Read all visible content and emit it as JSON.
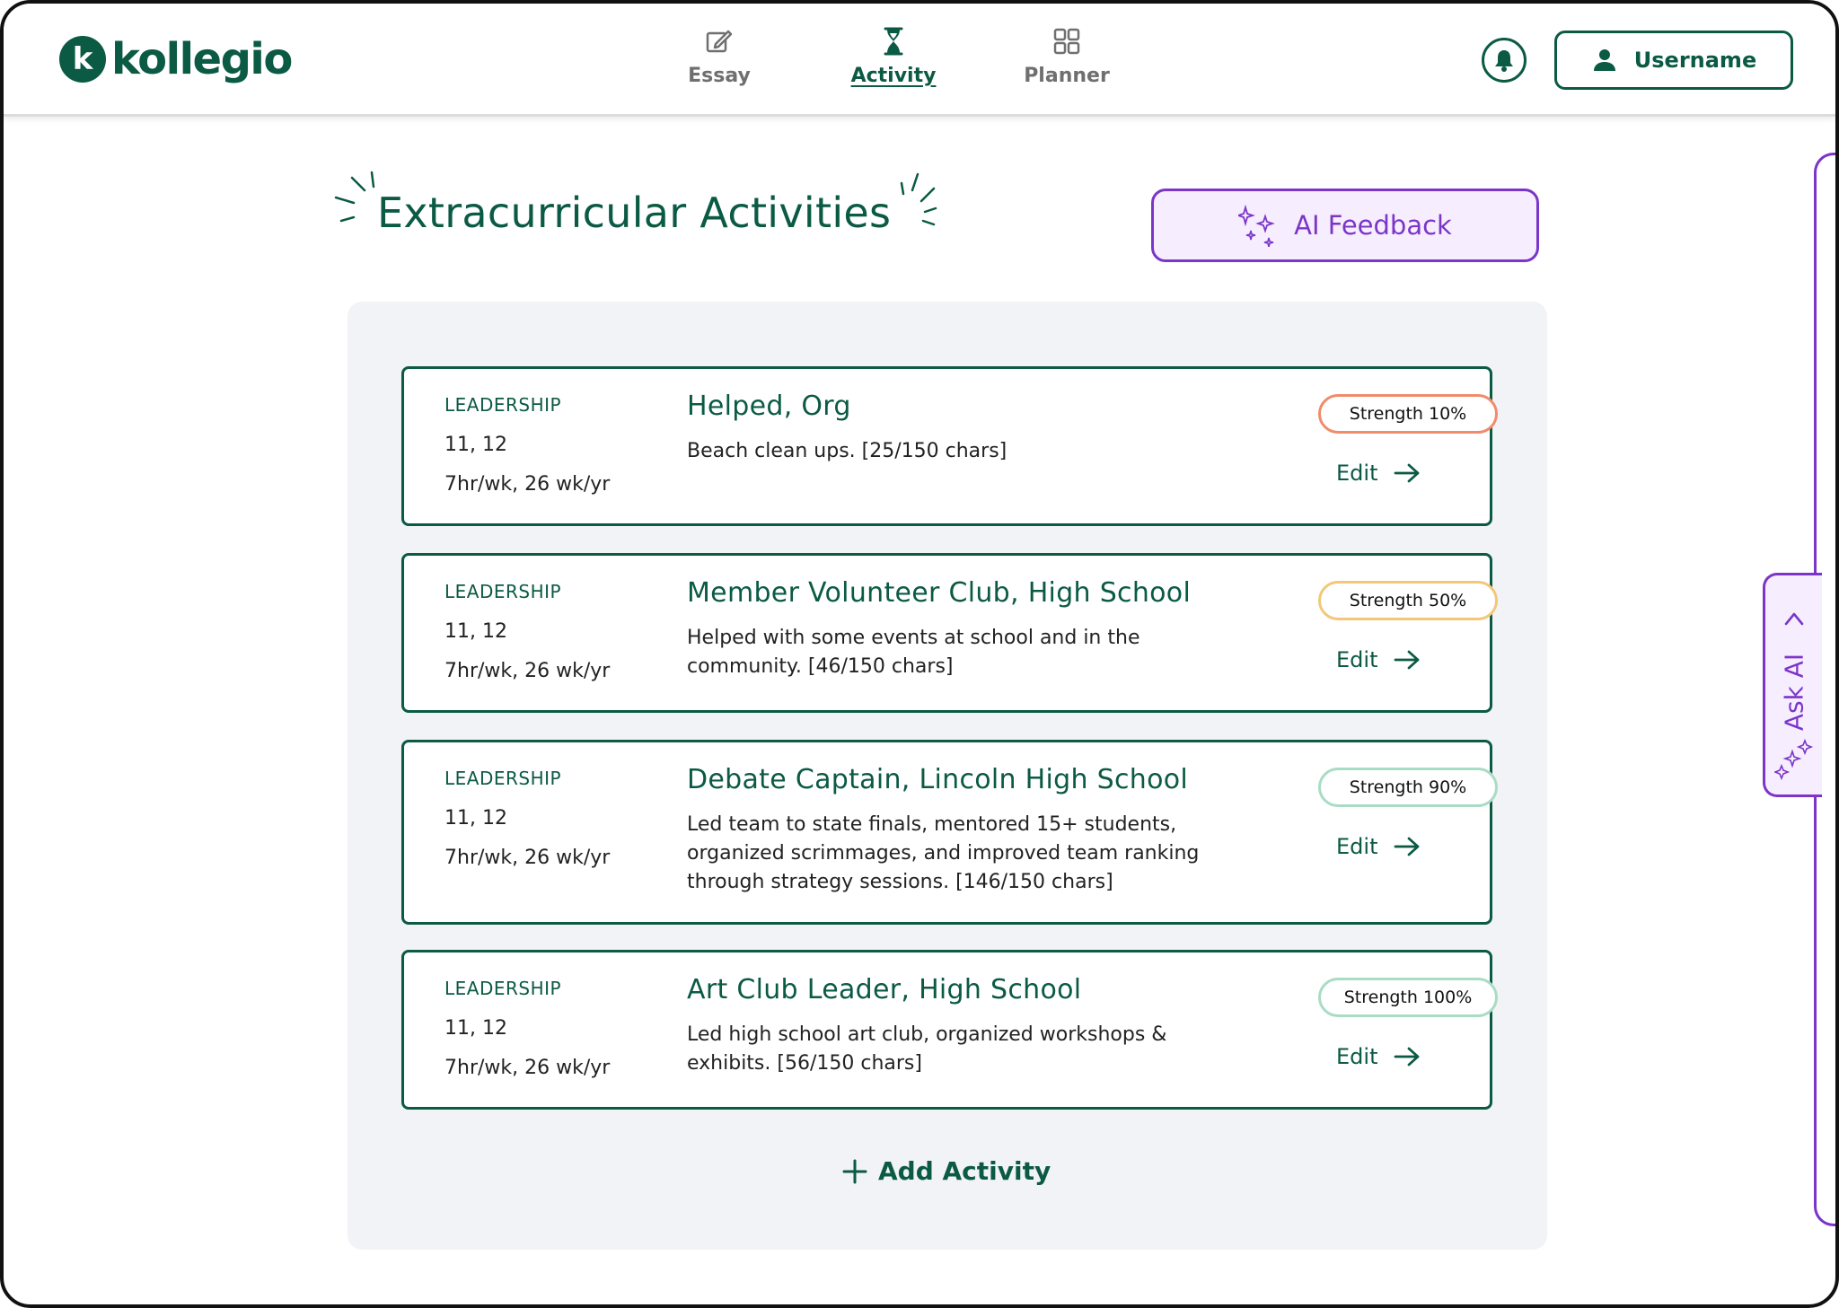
{
  "app": {
    "logo_text": "kollegio",
    "logo_mark": "k"
  },
  "nav": {
    "items": [
      {
        "label": "Essay",
        "icon": "edit-icon",
        "active": false
      },
      {
        "label": "Activity",
        "icon": "hourglass-icon",
        "active": true
      },
      {
        "label": "Planner",
        "icon": "grid-icon",
        "active": false
      }
    ]
  },
  "header": {
    "username": "Username"
  },
  "page": {
    "title": "Extracurricular Activities",
    "ai_feedback_label": "AI Feedback"
  },
  "activities": [
    {
      "category": "LEADERSHIP",
      "grades": "11, 12",
      "time": "7hr/wk, 26 wk/yr",
      "name": "Helped, Org",
      "description": "Beach clean ups. [25/150 chars]",
      "strength": "Strength 10%",
      "strength_color": "#f08c6a",
      "edit_label": "Edit"
    },
    {
      "category": "LEADERSHIP",
      "grades": "11, 12",
      "time": "7hr/wk, 26 wk/yr",
      "name": "Member Volunteer Club, High School",
      "description": "Helped with some events at school and in the community. [46/150 chars]",
      "strength": "Strength 50%",
      "strength_color": "#f3c77a",
      "edit_label": "Edit"
    },
    {
      "category": "LEADERSHIP",
      "grades": "11, 12",
      "time": "7hr/wk, 26 wk/yr",
      "name": "Debate Captain, Lincoln High School",
      "description": "Led team to state finals, mentored 15+ students, organized scrimmages, and improved team ranking through strategy sessions. [146/150 chars]",
      "strength": "Strength 90%",
      "strength_color": "#a9dcc5",
      "edit_label": "Edit"
    },
    {
      "category": "LEADERSHIP",
      "grades": "11, 12",
      "time": "7hr/wk, 26 wk/yr",
      "name": "Art Club Leader, High School",
      "description": "Led high school art club, organized workshops & exhibits. [56/150 chars]",
      "strength": "Strength 100%",
      "strength_color": "#a9dcc5",
      "edit_label": "Edit"
    }
  ],
  "add_activity_label": "Add Activity",
  "ask_ai_label": "Ask AI",
  "colors": {
    "brand": "#0b5a44",
    "ai_purple": "#7b35c8",
    "ai_bg": "#f6eefe",
    "panel_bg": "#f2f3f6"
  }
}
